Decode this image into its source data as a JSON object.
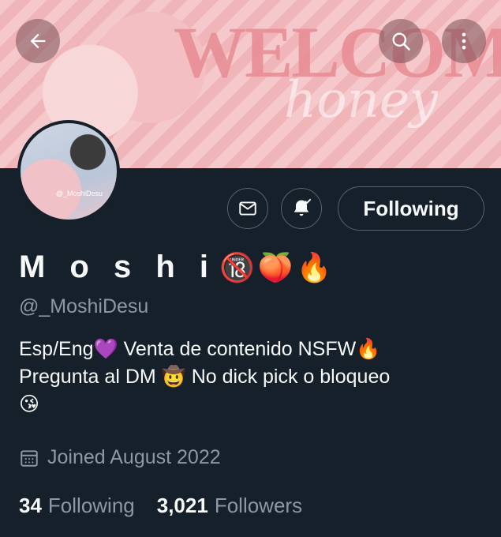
{
  "banner": {
    "headline": "WELCOME",
    "subline": "honey"
  },
  "avatar": {
    "watermark": "@_MoshiDesu"
  },
  "actions": {
    "follow_label": "Following"
  },
  "profile": {
    "name": "M o s h i",
    "name_emojis": [
      "🔞",
      "🍑",
      "🔥"
    ],
    "handle": "@_MoshiDesu",
    "bio_line1": "Esp/Eng💜 Venta de contenido NSFW🔥",
    "bio_line2": "Pregunta al DM 🤠 No dick pick o bloqueo",
    "bio_line3": "😘",
    "joined": "Joined August 2022"
  },
  "stats": {
    "following_count": "34",
    "following_label": "Following",
    "followers_count": "3,021",
    "followers_label": "Followers"
  },
  "icons": [
    "back-arrow-icon",
    "search-icon",
    "more-vertical-icon",
    "mail-icon",
    "notification-bell-icon",
    "calendar-icon"
  ]
}
